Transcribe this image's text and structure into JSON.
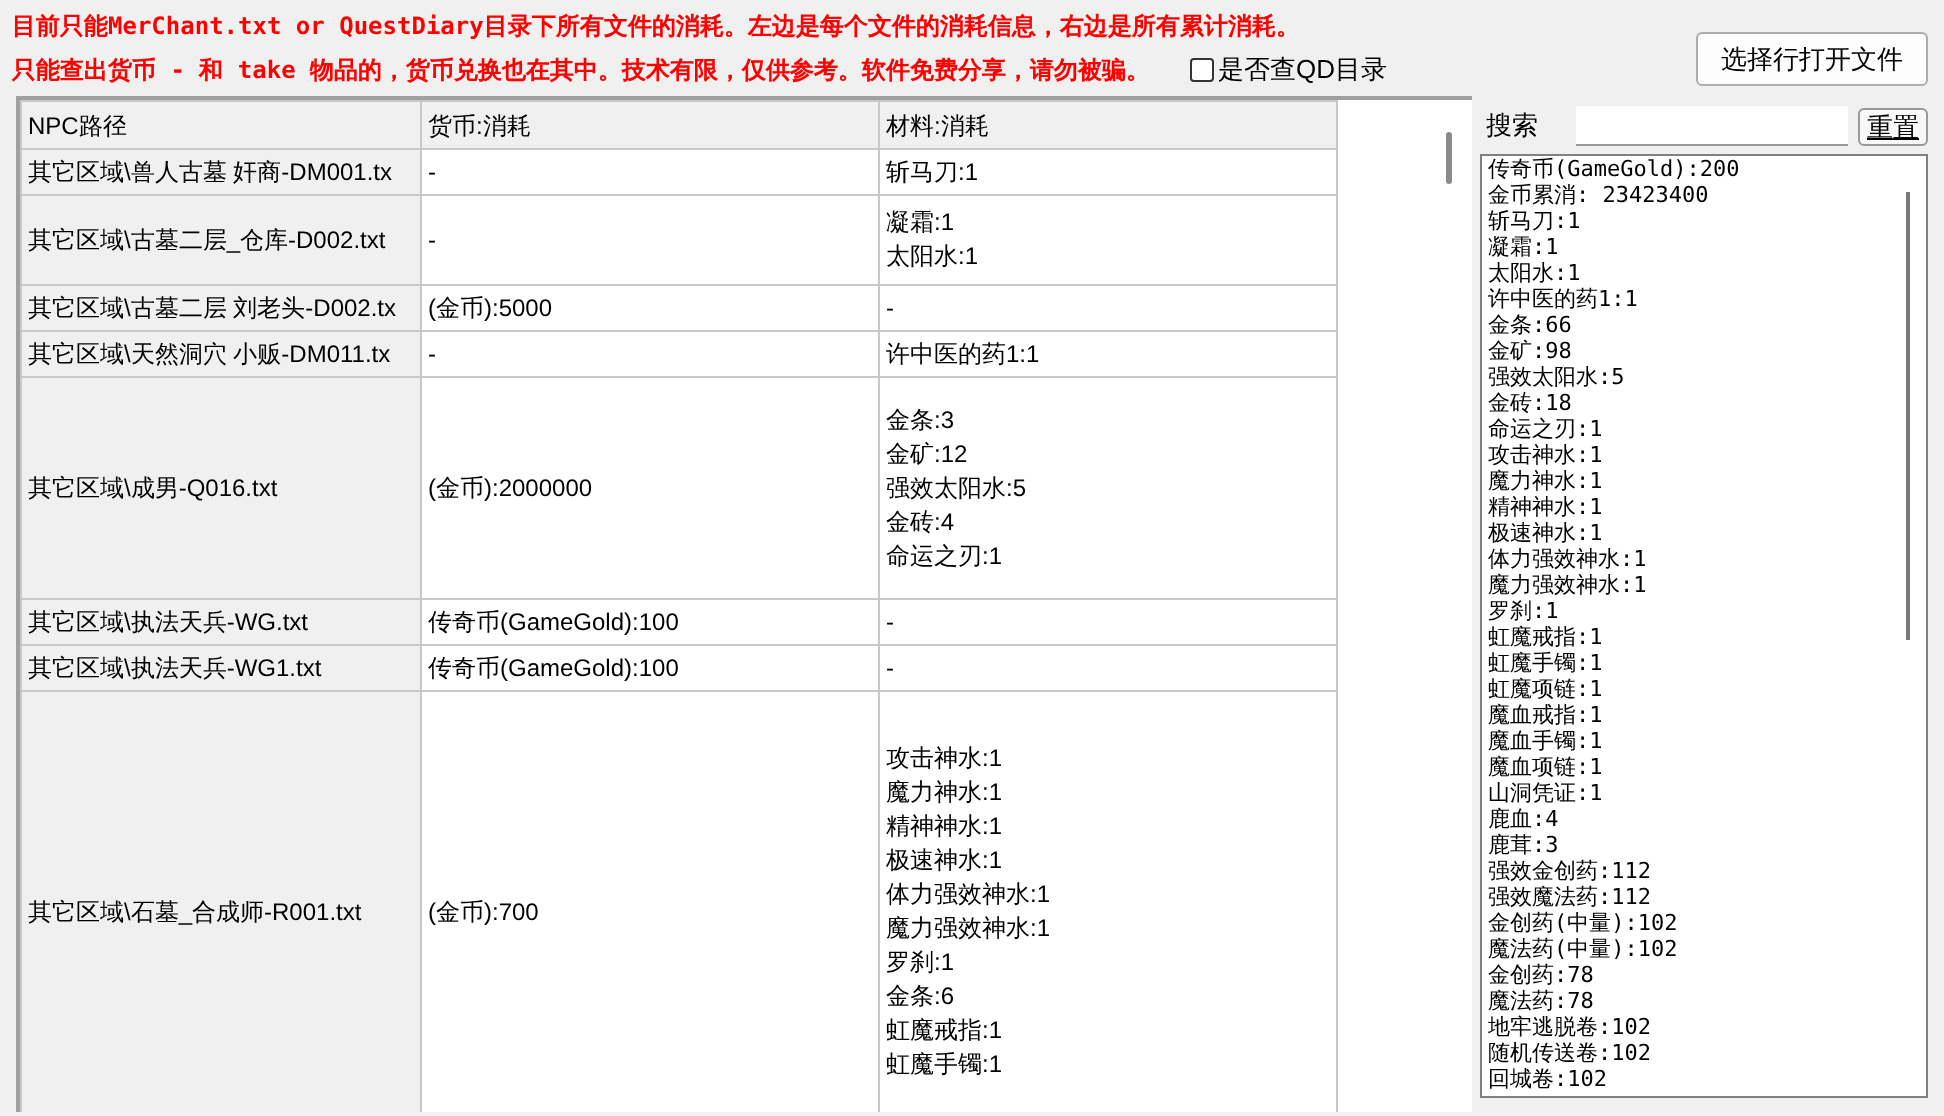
{
  "notice_lines": [
    "目前只能MerChant.txt or QuestDiary目录下所有文件的消耗。左边是每个文件的消耗信息，右边是所有累计消耗。",
    "只能查出货币 - 和 take 物品的，货币兑换也在其中。技术有限，仅供参考。软件免费分享，请勿被骗。"
  ],
  "qd_checkbox": {
    "label": "是否查QD目录",
    "checked": false
  },
  "open_button": "选择行打开文件",
  "table": {
    "columns": [
      "NPC路径",
      "货币:消耗",
      "材料:消耗"
    ],
    "rows": [
      {
        "npc_path": "其它区域\\兽人古墓 奸商-DM001.tx",
        "currency": "-",
        "materials": [
          "斩马刀:1"
        ]
      },
      {
        "npc_path": "其它区域\\古墓二层_仓库-D002.txt",
        "currency": "-",
        "materials": [
          "凝霜:1",
          "太阳水:1"
        ]
      },
      {
        "npc_path": "其它区域\\古墓二层 刘老头-D002.tx",
        "currency": "(金币):5000",
        "materials": [
          "-"
        ]
      },
      {
        "npc_path": "其它区域\\天然洞穴 小贩-DM011.tx",
        "currency": "-",
        "materials": [
          "许中医的药1:1"
        ]
      },
      {
        "npc_path": "其它区域\\成男-Q016.txt",
        "currency": "(金币):2000000",
        "materials": [
          "金条:3",
          "金矿:12",
          "强效太阳水:5",
          "金砖:4",
          "命运之刃:1"
        ]
      },
      {
        "npc_path": "其它区域\\执法天兵-WG.txt",
        "currency": "传奇币(GameGold):100",
        "materials": [
          "-"
        ]
      },
      {
        "npc_path": "其它区域\\执法天兵-WG1.txt",
        "currency": "传奇币(GameGold):100",
        "materials": [
          "-"
        ]
      },
      {
        "npc_path": "其它区域\\石墓_合成师-R001.txt",
        "currency": "(金币):700",
        "materials": [
          "攻击神水:1",
          "魔力神水:1",
          "精神神水:1",
          "极速神水:1",
          "体力强效神水:1",
          "魔力强效神水:1",
          "罗刹:1",
          "金条:6",
          "虹魔戒指:1",
          "虹魔手镯:1"
        ]
      }
    ]
  },
  "search": {
    "label": "搜索"
  },
  "reset_button": "重置",
  "totals": [
    "传奇币(GameGold):200",
    "金币累消: 23423400",
    "斩马刀:1",
    "凝霜:1",
    "太阳水:1",
    "许中医的药1:1",
    "金条:66",
    "金矿:98",
    "强效太阳水:5",
    "金砖:18",
    "命运之刃:1",
    "攻击神水:1",
    "魔力神水:1",
    "精神神水:1",
    "极速神水:1",
    "体力强效神水:1",
    "魔力强效神水:1",
    "罗刹:1",
    "虹魔戒指:1",
    "虹魔手镯:1",
    "虹魔项链:1",
    "魔血戒指:1",
    "魔血手镯:1",
    "魔血项链:1",
    "山洞凭证:1",
    "鹿血:4",
    "鹿茸:3",
    "强效金创药:112",
    "强效魔法药:112",
    "金创药(中量):102",
    "魔法药(中量):102",
    "金创药:78",
    "魔法药:78",
    "地牢逃脱卷:102",
    "随机传送卷:102",
    "回城卷:102"
  ]
}
